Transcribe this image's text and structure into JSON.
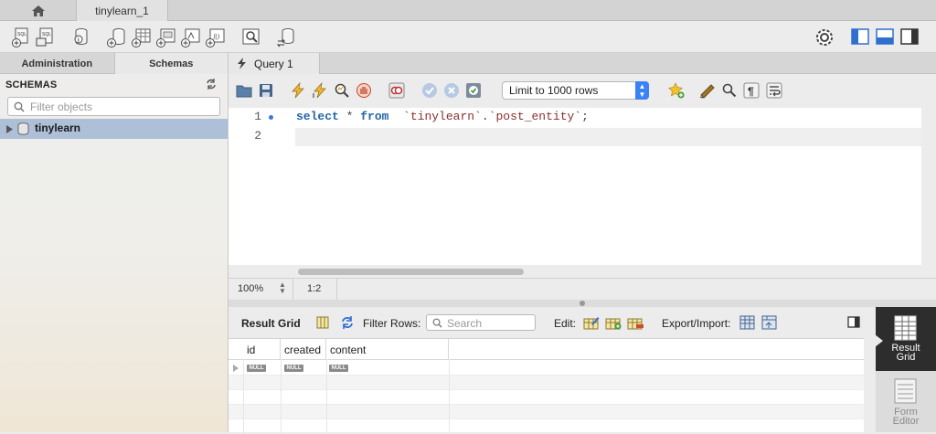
{
  "tabs": {
    "home_icon": "home-icon",
    "connection_tab": "tinylearn_1"
  },
  "main_toolbar": {
    "icons": [
      "new-sql-tab-icon",
      "open-sql-script-icon",
      "schema-inspector-icon",
      "create-schema-icon",
      "create-table-icon",
      "create-view-icon",
      "create-procedure-icon",
      "create-function-icon",
      "search-table-data-icon",
      "reconnect-icon",
      "settings-icon",
      "toggle-sidebar-icon",
      "toggle-output-icon",
      "toggle-secondary-sidebar-icon"
    ]
  },
  "left_panel": {
    "tabs": [
      "Administration",
      "Schemas"
    ],
    "active_tab": "Schemas",
    "title": "SCHEMAS",
    "filter_placeholder": "Filter objects",
    "schemas": [
      {
        "name": "tinylearn",
        "expanded": false
      }
    ]
  },
  "query_tab": {
    "label": "Query 1"
  },
  "editor_toolbar": {
    "limit_select": "Limit to 1000 rows"
  },
  "editor": {
    "line_numbers": [
      "1",
      "2"
    ],
    "code": {
      "kw1": "select",
      "op": " * ",
      "kw2": "from",
      "space": "  ",
      "db": "`tinylearn`",
      "dot": ".",
      "table": "`post_entity`",
      "end": ";"
    }
  },
  "status_bar": {
    "zoom": "100%",
    "cursor_pos": "1:2"
  },
  "result_toolbar": {
    "title": "Result Grid",
    "filter_label": "Filter Rows:",
    "search_placeholder": "Search",
    "edit_label": "Edit:",
    "export_label": "Export/Import:"
  },
  "grid": {
    "columns": [
      "id",
      "created",
      "content"
    ],
    "rows": [
      [
        "NULL",
        "NULL",
        "NULL"
      ]
    ]
  },
  "side_panel": {
    "result_grid_line1": "Result",
    "result_grid_line2": "Grid",
    "form_editor_line1": "Form",
    "form_editor_line2": "Editor"
  },
  "colors": {
    "selected_schema_row": "#aebfd8",
    "keyword": "#2467a6",
    "string": "#8b2f2f",
    "limit_select_arrow": "#3b82f6"
  }
}
